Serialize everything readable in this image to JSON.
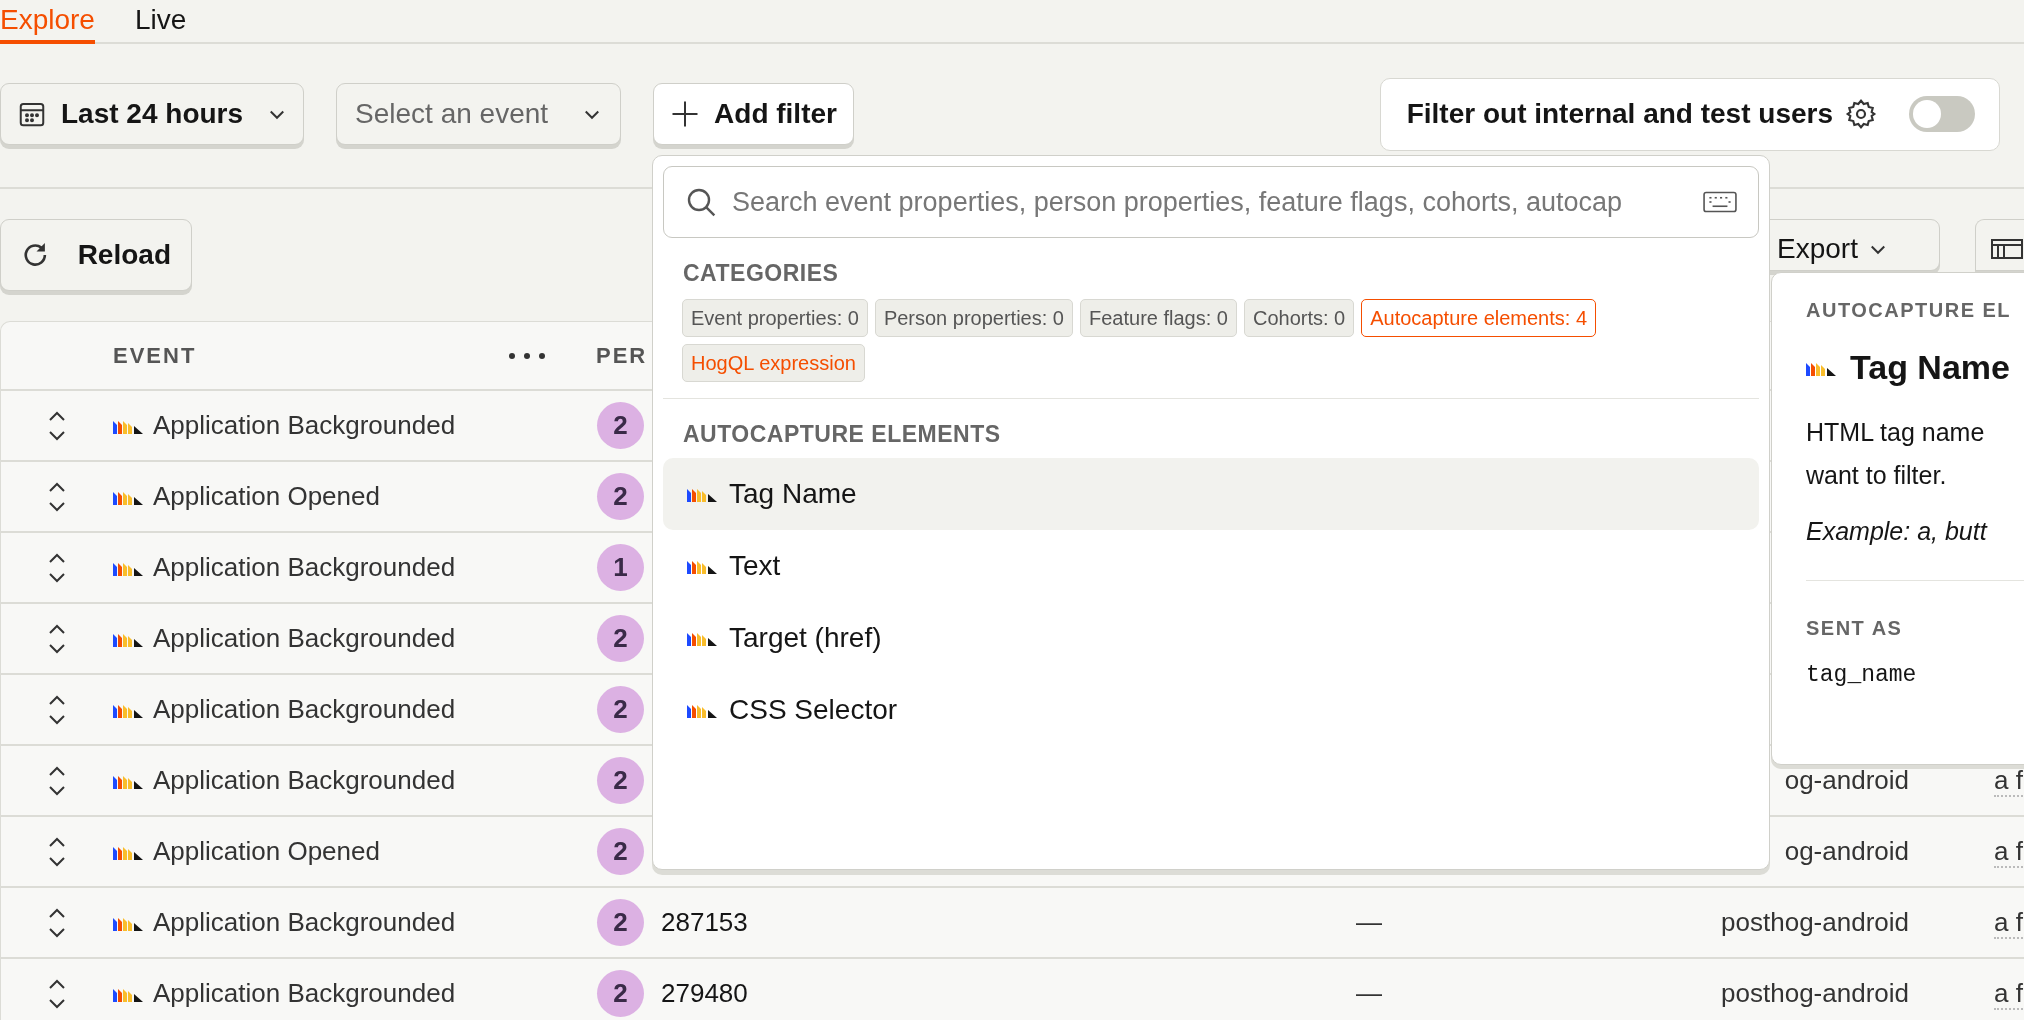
{
  "tabs": [
    {
      "label": "Explore",
      "selected": true
    },
    {
      "label": "Live",
      "selected": false
    }
  ],
  "filters": {
    "date_range": "Last 24 hours",
    "event_select": {
      "placeholder": "Select an event"
    },
    "add_filter": "Add filter",
    "internal_users_toggle": {
      "label": "Filter out internal and test users",
      "on": false
    }
  },
  "toolbar": {
    "reload": "Reload",
    "export": "Export"
  },
  "table": {
    "columns": [
      "EVENT",
      "PER"
    ],
    "rows": [
      {
        "event": "Application Backgrounded",
        "person": "2"
      },
      {
        "event": "Application Opened",
        "person": "2"
      },
      {
        "event": "Application Backgrounded",
        "person": "1"
      },
      {
        "event": "Application Backgrounded",
        "person": "2"
      },
      {
        "event": "Application Backgrounded",
        "person": "2"
      },
      {
        "event": "Application Backgrounded",
        "person": "2",
        "column_5": "og-android",
        "column_6": "a f"
      },
      {
        "event": "Application Opened",
        "person": "2",
        "column_5": "og-android",
        "column_6": "a f"
      },
      {
        "event": "Application Backgrounded",
        "person": "2",
        "column_3": "287153",
        "column_4": "—",
        "column_5": "posthog-android",
        "column_6": "a f"
      },
      {
        "event": "Application Backgrounded",
        "person": "2",
        "column_3": "279480",
        "column_4": "—",
        "column_5": "posthog-android",
        "column_6": "a f"
      }
    ]
  },
  "filter_popup": {
    "search": {
      "placeholder": "Search event properties, person properties, feature flags, cohorts, autocap"
    },
    "categories_title": "CATEGORIES",
    "categories": [
      {
        "label": "Event properties: 0",
        "kind": "count",
        "selected": false
      },
      {
        "label": "Person properties: 0",
        "kind": "count",
        "selected": false
      },
      {
        "label": "Feature flags: 0",
        "kind": "count",
        "selected": false
      },
      {
        "label": "Cohorts: 0",
        "kind": "count",
        "selected": false
      },
      {
        "label": "Autocapture elements: 4",
        "kind": "count",
        "selected": true
      },
      {
        "label": "HogQL expression",
        "kind": "expression",
        "selected": false
      }
    ],
    "section_title": "AUTOCAPTURE ELEMENTS",
    "items": [
      {
        "label": "Tag Name",
        "selected": true
      },
      {
        "label": "Text",
        "selected": false
      },
      {
        "label": "Target (href)",
        "selected": false
      },
      {
        "label": "CSS Selector",
        "selected": false
      }
    ]
  },
  "detail_panel": {
    "category": "AUTOCAPTURE EL",
    "title": "Tag Name",
    "description": [
      "HTML tag name",
      "want to filter."
    ],
    "example": "Example: a, butt",
    "sent_as_label": "SENT AS",
    "sent_as": "tag_name"
  }
}
